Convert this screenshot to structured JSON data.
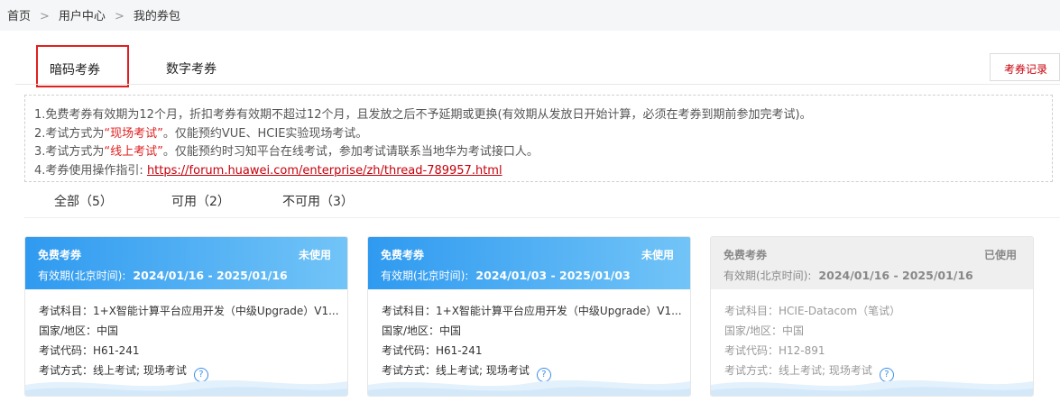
{
  "breadcrumb": {
    "items": [
      "首页",
      "用户中心",
      "我的券包"
    ],
    "separator": ">"
  },
  "tabs": {
    "code_voucher": "暗码考券",
    "digital_voucher": "数字考券"
  },
  "record_button": "考券记录",
  "notice": {
    "line1": "1.免费考券有效期为12个月，折扣考券有效期不超过12个月，且发放之后不予延期或更换(有效期从发放日开始计算，必须在考券到期前参加完考试)。",
    "line2_prefix": "2.考试方式为",
    "line2_highlight": "“现场考试”",
    "line2_suffix": "。仅能预约VUE、HCIE实验现场考试。",
    "line3_prefix": "3.考试方式为",
    "line3_highlight": "“线上考试”",
    "line3_suffix": "。仅能预约时习知平台在线考试，参加考试请联系当地华为考试接口人。",
    "line4_prefix": "4.考券使用操作指引:",
    "line4_link": "https://forum.huawei.com/enterprise/zh/thread-789957.html"
  },
  "filters": [
    "全部（5）",
    "可用（2）",
    "不可用（3）"
  ],
  "labels": {
    "validity": "有效期(北京时间):",
    "subject": "考试科目：",
    "region": "国家/地区：",
    "code": "考试代码：",
    "mode": "考试方式："
  },
  "cards": [
    {
      "type": "免费考券",
      "status": "未使用",
      "validity": "2024/01/16 - 2025/01/16",
      "subject": "1+X智能计算平台应用开发（中级Upgrade）V1...",
      "region": "中国",
      "code": "H61-241",
      "mode": "线上考试; 现场考试"
    },
    {
      "type": "免费考券",
      "status": "未使用",
      "validity": "2024/01/03 - 2025/01/03",
      "subject": "1+X智能计算平台应用开发（中级Upgrade）V1...",
      "region": "中国",
      "code": "H61-241",
      "mode": "线上考试; 现场考试"
    },
    {
      "type": "免费考券",
      "status": "已使用",
      "validity": "2024/01/16 - 2025/01/16",
      "subject": "HCIE-Datacom（笔试）",
      "region": "中国",
      "code": "H12-891",
      "mode": "线上考试; 现场考试"
    }
  ],
  "colors": {
    "accent_red": "#c7000b",
    "highlight_red": "#e02020",
    "card_blue_start": "#2f9af0",
    "card_blue_end": "#72c4f7",
    "used_grey": "#efefef"
  },
  "icons": {
    "help": "question-circle-icon"
  }
}
